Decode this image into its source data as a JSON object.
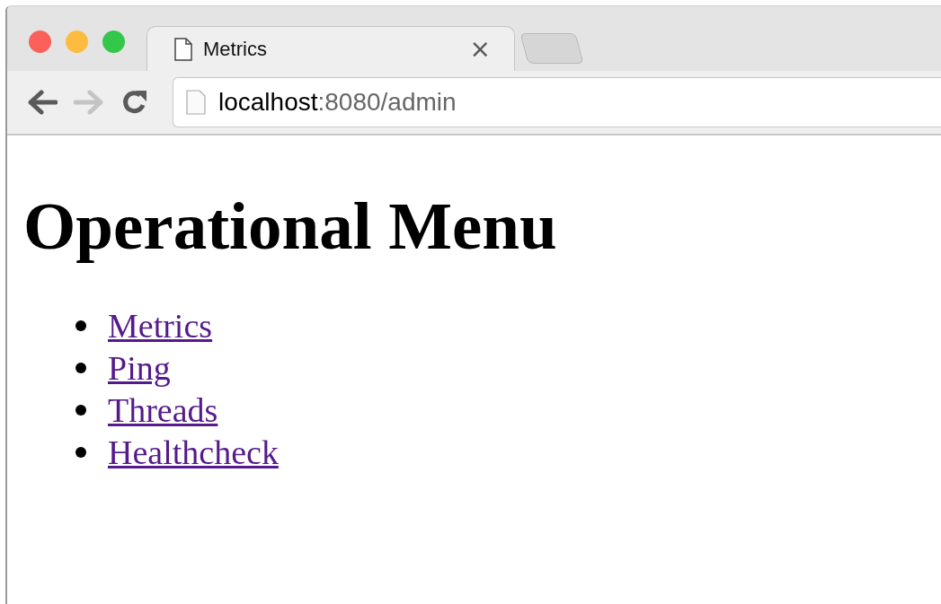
{
  "tab": {
    "title": "Metrics",
    "close": "×"
  },
  "toolbar": {
    "back": {
      "disabled": false
    },
    "forward": {
      "disabled": true
    },
    "url": {
      "host": "localhost",
      "path": ":8080/admin"
    }
  },
  "page": {
    "heading": "Operational Menu",
    "links": [
      {
        "label": "Metrics"
      },
      {
        "label": "Ping"
      },
      {
        "label": "Threads"
      },
      {
        "label": "Healthcheck"
      }
    ]
  }
}
